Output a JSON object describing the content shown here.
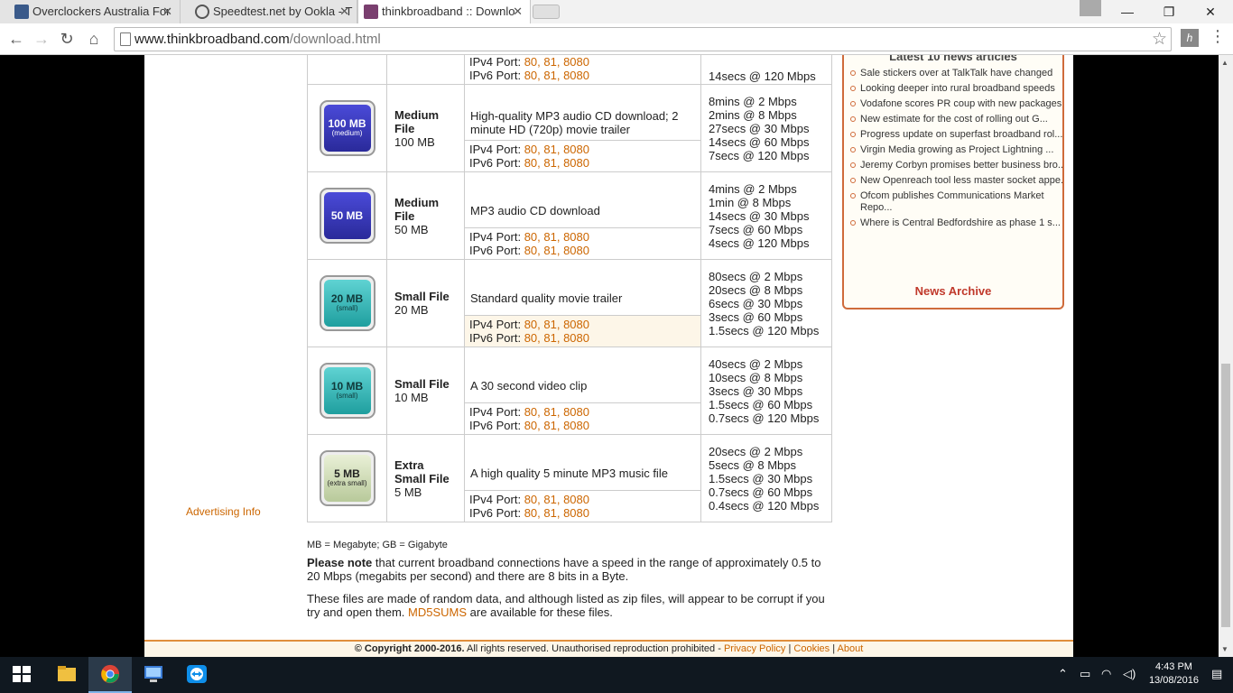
{
  "browser": {
    "tabs": [
      {
        "title": "Overclockers Australia For",
        "favicon": "oc-au-icon"
      },
      {
        "title": "Speedtest.net by Ookla - T",
        "favicon": "speedtest-icon"
      },
      {
        "title": "thinkbroadband :: Downlo",
        "favicon": "thinkbroadband-icon"
      }
    ],
    "url_host": "www.thinkbroadband.com",
    "url_path": "/download.html",
    "close_glyph": "✕",
    "minimize_glyph": "—",
    "restore_glyph": "❐",
    "back_glyph": "←",
    "forward_glyph": "→",
    "reload_glyph": "↻",
    "home_glyph": "⌂",
    "star_glyph": "☆",
    "menu_glyph": "⋮",
    "ext_label": "h"
  },
  "sidebar_left": {
    "advertising_info": "Advertising Info"
  },
  "ports": {
    "ipv4_label": "IPv4 Port:",
    "ipv6_label": "IPv6 Port:",
    "list": "80, 81, 8080"
  },
  "files": [
    {
      "icon_top": "",
      "icon_sub": "",
      "icon_style": "blue",
      "name": "",
      "size": "",
      "description": "",
      "times": [
        "14secs @ 120 Mbps"
      ]
    },
    {
      "icon_top": "100 MB",
      "icon_sub": "(medium)",
      "icon_style": "blue",
      "name": "Medium File",
      "size": "100 MB",
      "description": "High-quality MP3 audio CD download; 2 minute HD (720p) movie trailer",
      "times": [
        "8mins @ 2 Mbps",
        "2mins @ 8 Mbps",
        "27secs @ 30 Mbps",
        "14secs @ 60 Mbps",
        "7secs @ 120 Mbps"
      ]
    },
    {
      "icon_top": "50 MB",
      "icon_sub": "",
      "icon_style": "blue",
      "name": "Medium File",
      "size": "50 MB",
      "description": "MP3 audio CD download",
      "times": [
        "4mins @ 2 Mbps",
        "1min @ 8 Mbps",
        "14secs @ 30 Mbps",
        "7secs @ 60 Mbps",
        "4secs @ 120 Mbps"
      ]
    },
    {
      "icon_top": "20 MB",
      "icon_sub": "(small)",
      "icon_style": "teal",
      "name": "Small File",
      "size": "20 MB",
      "description": "Standard quality movie trailer",
      "times": [
        "80secs @ 2 Mbps",
        "20secs @ 8 Mbps",
        "6secs @ 30 Mbps",
        "3secs @ 60 Mbps",
        "1.5secs @ 120 Mbps"
      ]
    },
    {
      "icon_top": "10 MB",
      "icon_sub": "(small)",
      "icon_style": "teal",
      "name": "Small File",
      "size": "10 MB",
      "description": "A 30 second video clip",
      "times": [
        "40secs @ 2 Mbps",
        "10secs @ 8 Mbps",
        "3secs @ 30 Mbps",
        "1.5secs @ 60 Mbps",
        "0.7secs @ 120 Mbps"
      ]
    },
    {
      "icon_top": "5 MB",
      "icon_sub": "(extra small)",
      "icon_style": "green",
      "name": "Extra Small File",
      "size": "5 MB",
      "description": "A high quality 5 minute MP3 music file",
      "times": [
        "20secs @ 2 Mbps",
        "5secs @ 8 Mbps",
        "1.5secs @ 30 Mbps",
        "0.7secs @ 60 Mbps",
        "0.4secs @ 120 Mbps"
      ]
    }
  ],
  "notes": {
    "units": "MB = Megabyte; GB = Gigabyte",
    "please_note_bold": "Please note",
    "please_note_rest": " that current broadband connections have a speed in the range of approximately 0.5 to 20 Mbps (megabits per second) and there are 8 bits in a Byte.",
    "random_data_pre": "These files are made of random data, and although listed as zip files, will appear to be corrupt if you try and open them. ",
    "md5_link": "MD5SUMS",
    "random_data_post": " are available for these files."
  },
  "news": {
    "heading": "Latest 10 news articles",
    "items": [
      "Sale stickers over at TalkTalk have changed",
      "Looking deeper into rural broadband speeds",
      "Vodafone scores PR coup with new packages",
      "New estimate for the cost of rolling out G...",
      "Progress update on superfast broadband rol...",
      "Virgin Media growing as Project Lightning ...",
      "Jeremy Corbyn promises better business bro...",
      "New Openreach tool less master socket appe...",
      "Ofcom publishes Communications Market Repo...",
      "Where is Central Bedfordshire as phase 1 s..."
    ],
    "archive_label": "News Archive"
  },
  "footer": {
    "copyright": "© Copyright 2000-2016.",
    "rights": " All rights reserved. Unauthorised reproduction prohibited - ",
    "privacy": "Privacy Policy",
    "cookies": "Cookies",
    "about": "About",
    "sep": " | "
  },
  "taskbar": {
    "time": "4:43 PM",
    "date": "13/08/2016",
    "tray_up": "⌃",
    "tray_battery": "▭",
    "tray_wifi": "◠",
    "tray_volume": "◁)",
    "tray_notify": "▤"
  },
  "colors": {
    "accent_orange": "#cc6600",
    "news_border": "#cf6b3b",
    "news_archive": "#c0392b"
  }
}
